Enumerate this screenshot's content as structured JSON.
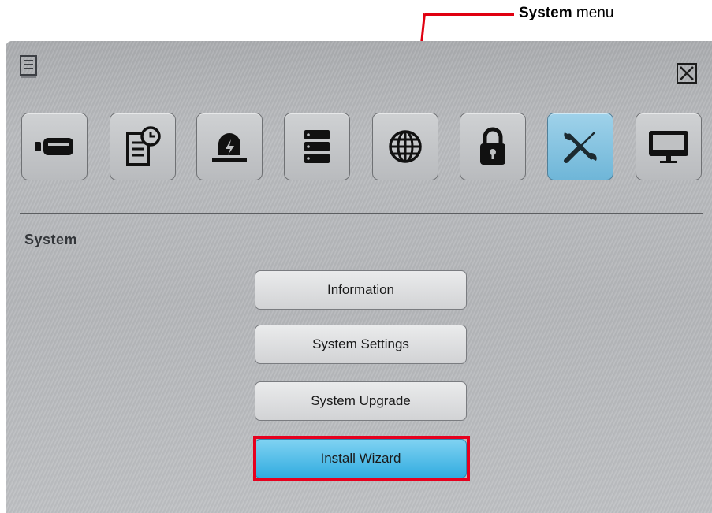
{
  "callout": {
    "bold": "System",
    "rest": " menu"
  },
  "tabs": [
    {
      "name": "camera"
    },
    {
      "name": "record-schedule"
    },
    {
      "name": "alarm"
    },
    {
      "name": "storage"
    },
    {
      "name": "network"
    },
    {
      "name": "security"
    },
    {
      "name": "system",
      "active": true
    },
    {
      "name": "display"
    }
  ],
  "section": {
    "title": "System"
  },
  "buttons": {
    "information": "Information",
    "system_settings": "System Settings",
    "system_upgrade": "System Upgrade",
    "install_wizard": "Install Wizard"
  },
  "colors": {
    "accent": "#e6001e",
    "active_tab": "#6fb6d8",
    "wizard_button": "#32ace0"
  }
}
